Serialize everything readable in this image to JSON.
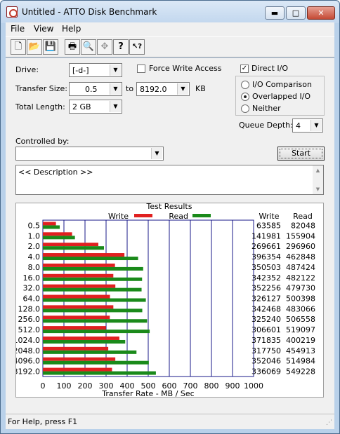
{
  "window": {
    "title": "Untitled - ATTO Disk Benchmark",
    "min": "▬",
    "max": "□",
    "close": "✕"
  },
  "menu": {
    "file": "File",
    "view": "View",
    "help": "Help"
  },
  "toolbar": {
    "buttons": [
      {
        "icon": "new-document-icon",
        "glyph": "🗋"
      },
      {
        "icon": "open-folder-icon",
        "glyph": "📂"
      },
      {
        "icon": "save-icon",
        "glyph": "💾"
      },
      {
        "icon": "print-icon",
        "glyph": "🖶"
      },
      {
        "icon": "print-preview-icon",
        "glyph": "🔍"
      },
      {
        "icon": "move-icon",
        "glyph": "✥"
      },
      {
        "icon": "help-icon",
        "glyph": "?"
      },
      {
        "icon": "context-help-icon",
        "glyph": "↖?"
      }
    ]
  },
  "settings": {
    "drive_label": "Drive:",
    "drive_value": "[-d-]",
    "force_write_label": "Force Write Access",
    "force_write_checked": false,
    "direct_io_label": "Direct I/O",
    "direct_io_checked": true,
    "transfer_size_label": "Transfer Size:",
    "transfer_from": "0.5",
    "to_label": "to",
    "transfer_to": "8192.0",
    "kb_label": "KB",
    "total_length_label": "Total Length:",
    "total_length_value": "2 GB",
    "io_comparison_label": "I/O Comparison",
    "overlapped_io_label": "Overlapped I/O",
    "neither_label": "Neither",
    "selected_mode": "Overlapped I/O",
    "queue_depth_label": "Queue Depth:",
    "queue_depth_value": "4",
    "controlled_by_label": "Controlled by:",
    "controlled_by_value": "",
    "start_label": "Start",
    "description": "<< Description >>"
  },
  "results": {
    "title": "Test Results",
    "legend_write": "Write",
    "legend_read": "Read",
    "col_write": "Write",
    "col_read": "Read",
    "xlabel": "Transfer Rate - MB / Sec"
  },
  "colors": {
    "write": "#e02020",
    "read": "#1a8a1a",
    "grid": "#1a1a8a"
  },
  "chart_data": {
    "type": "bar",
    "orientation": "horizontal",
    "categories": [
      "0.5",
      "1.0",
      "2.0",
      "4.0",
      "8.0",
      "16.0",
      "32.0",
      "64.0",
      "128.0",
      "256.0",
      "512.0",
      "1024.0",
      "2048.0",
      "4096.0",
      "8192.0"
    ],
    "series": [
      {
        "name": "Write",
        "values": [
          63585,
          141981,
          269661,
          396354,
          350503,
          342352,
          352256,
          326127,
          342468,
          325240,
          306601,
          371835,
          317750,
          352046,
          336069
        ]
      },
      {
        "name": "Read",
        "values": [
          82048,
          155904,
          296960,
          462848,
          487424,
          482122,
          479730,
          500398,
          483066,
          506558,
          519097,
          400219,
          454913,
          514984,
          549228
        ]
      }
    ],
    "xlabel": "Transfer Rate - MB / Sec",
    "xlim": [
      0,
      1000
    ],
    "xticks": [
      "0",
      "100",
      "200",
      "300",
      "400",
      "500",
      "600",
      "700",
      "800",
      "900",
      "1000"
    ],
    "grid": true,
    "legend": "top"
  },
  "status": {
    "text": "For Help, press F1"
  }
}
